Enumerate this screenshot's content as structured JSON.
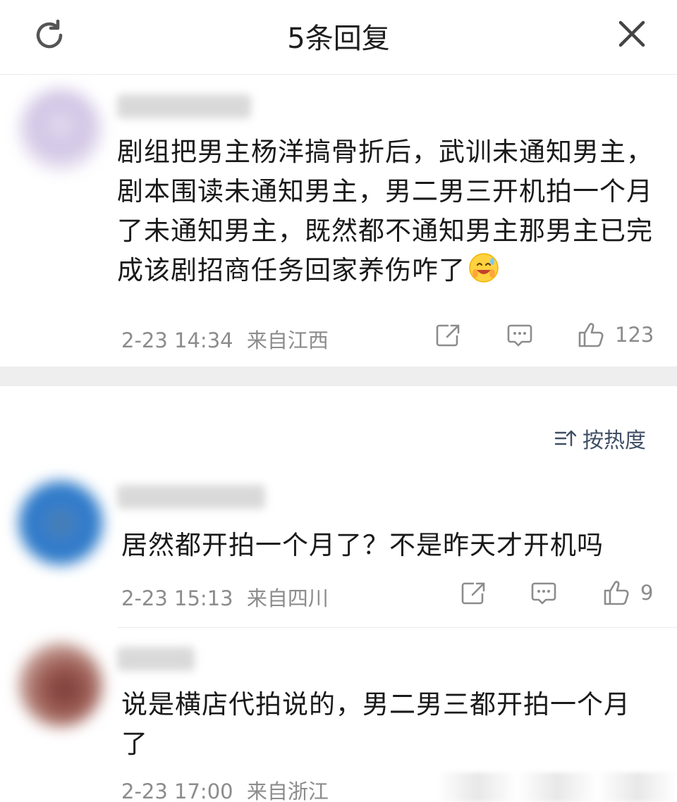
{
  "header": {
    "title": "5条回复",
    "refresh_icon": "refresh-icon",
    "close_icon": "close-icon"
  },
  "main_comment": {
    "text": "剧组把男主杨洋搞骨折后，武训未通知男主，剧本围读未通知男主，男二男三开机拍一个月了未通知男主，既然都不通知男主那男主已完成该剧招商任务回家养伤咋了",
    "emoji": "grinning-sweat-emoji",
    "time": "2-23 14:34",
    "location": "来自江西",
    "likes": "123"
  },
  "sort": {
    "label": "按热度"
  },
  "replies": [
    {
      "text": "居然都开拍一个月了？不是昨天才开机吗",
      "time": "2-23 15:13",
      "location": "来自四川",
      "likes": "9"
    },
    {
      "text": "说是横店代拍说的，男二男三都开拍一个月了",
      "time": "2-23 17:00",
      "location": "来自浙江"
    }
  ],
  "colors": {
    "text": "#1a1a1a",
    "meta": "#8c8c8c",
    "band": "#eeeeee",
    "sort": "#3f4f65"
  }
}
